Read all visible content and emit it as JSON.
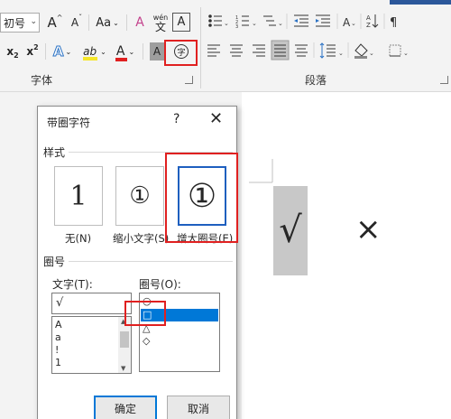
{
  "ribbon": {
    "font_size_value": "初号",
    "font_size_arrow": "⌄",
    "grow_font": "A",
    "shrink_font": "A",
    "change_case": "Aa",
    "clear_format": "A",
    "pinyin_top": "wén",
    "pinyin_char": "文",
    "char_border": "A",
    "subscript": "x",
    "subscript_mark": "2",
    "superscript": "x",
    "superscript_mark": "2",
    "text_effect": "A",
    "highlight": "ab",
    "font_color": "A",
    "char_shading": "A",
    "enclose_char": "字",
    "font_group_label": "字体",
    "paragraph_group_label": "段落",
    "colors": {
      "highlight": "#f5e62a",
      "font_color": "#e02020",
      "accent": "#2b579a",
      "red_box": "#e02020"
    }
  },
  "dialog": {
    "title": "带圈字符",
    "help": "?",
    "close": "✕",
    "style_section": "样式",
    "styles": [
      {
        "glyph": "1",
        "caption": "无(N)"
      },
      {
        "glyph": "①",
        "caption": "缩小文字(S)"
      },
      {
        "glyph": "①",
        "caption": "增大圈号(E)"
      }
    ],
    "enclosure_section": "圈号",
    "text_label": "文字(T):",
    "text_value": "√",
    "text_list": [
      "A",
      "a",
      "!",
      "1"
    ],
    "enclosure_label": "圈号(O):",
    "enclosure_list": [
      "○",
      "□",
      "△",
      "◇"
    ],
    "ok": "确定",
    "cancel": "取消"
  },
  "document": {
    "check_mark": "√",
    "cross_mark": "×"
  }
}
